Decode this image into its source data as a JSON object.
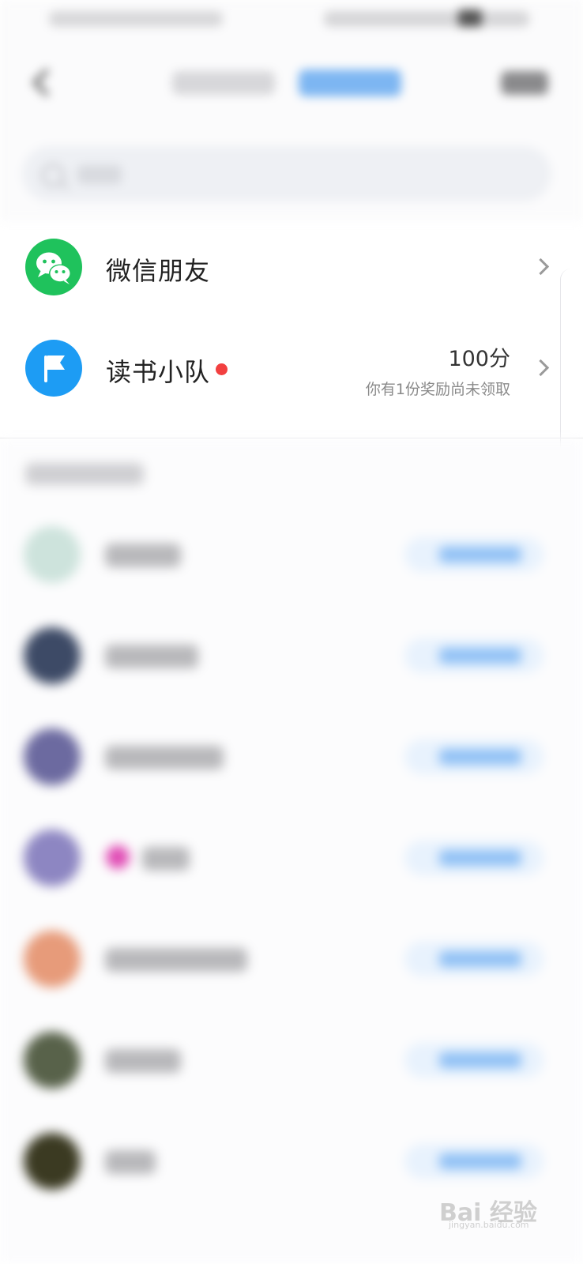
{
  "header": {
    "back_icon": "chevron-left-icon",
    "search_icon": "search-icon"
  },
  "entries": [
    {
      "icon": "wechat-icon",
      "title": "微信朋友",
      "accent": "#1fc25c"
    },
    {
      "icon": "flag-icon",
      "title": "读书小队",
      "score": "100分",
      "note": "你有1份奖励尚未领取",
      "accent": "#1d9cf4",
      "badge_color": "#f24040"
    }
  ],
  "watermark": {
    "text": "Bai 经验",
    "sub": "jingyan.baidu.com"
  },
  "colors": {
    "follow_button": "#8fc0f5",
    "text_secondary": "#8a8a8a"
  }
}
